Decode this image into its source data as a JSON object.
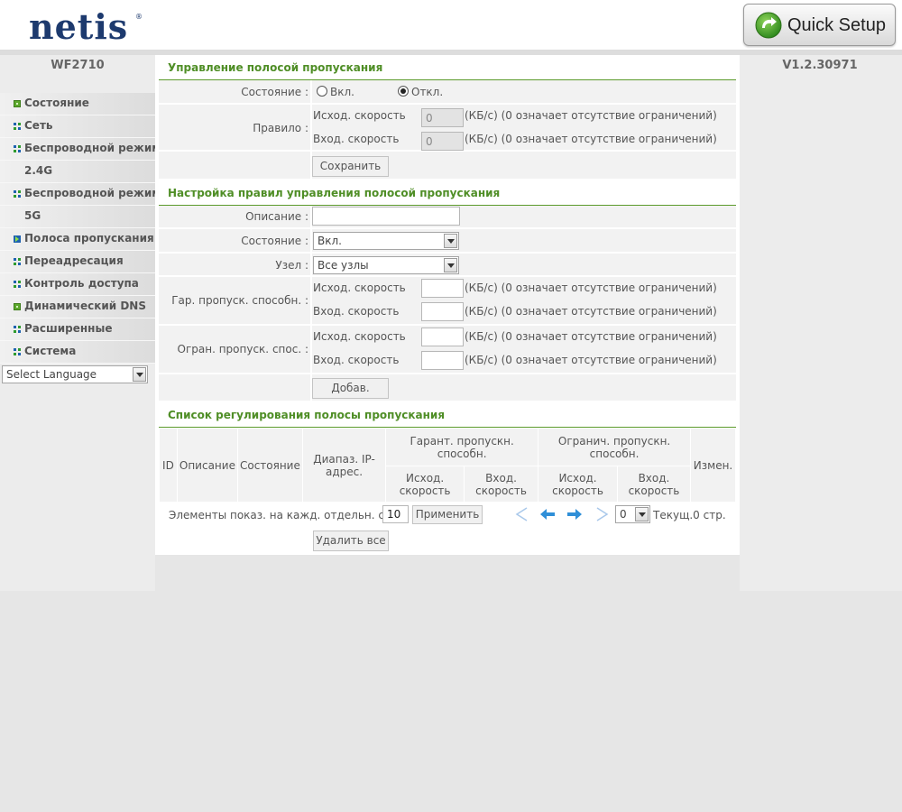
{
  "header": {
    "logo": "netis",
    "logo_mark": "®",
    "quick_setup_label": "Quick Setup",
    "quick_setup_icon": "refresh-arrow-icon"
  },
  "sidebar": {
    "model": "WF2710",
    "items": [
      {
        "label": "Состояние",
        "icon": "status-icon"
      },
      {
        "label": "Сеть",
        "icon": "grid-icon"
      },
      {
        "label": "Беспроводной режим",
        "icon": "grid-icon"
      },
      {
        "label": "2.4G",
        "icon": ""
      },
      {
        "label": "Беспроводной режим",
        "icon": "grid-icon"
      },
      {
        "label": "5G",
        "icon": ""
      },
      {
        "label": "Полоса пропускания",
        "icon": "active-arrow-icon"
      },
      {
        "label": "Переадресация",
        "icon": "grid-icon"
      },
      {
        "label": "Контроль доступа",
        "icon": "grid-icon"
      },
      {
        "label": "Динамический DNS",
        "icon": "status-icon"
      },
      {
        "label": "Расширенные",
        "icon": "grid-icon"
      },
      {
        "label": "Система",
        "icon": "grid-icon"
      }
    ],
    "language": "Select Language"
  },
  "version": "V1.2.30971",
  "bandwidth_control": {
    "title": "Управление полосой пропускания",
    "state_label": "Состояние :",
    "on_label": "Вкл.",
    "off_label": "Откл.",
    "selected": "off",
    "rule_label": "Правило :",
    "upload_label": "Исход. скорость",
    "download_label": "Вход. скорость",
    "upload_value": "0",
    "download_value": "0",
    "hint": "(КБ/с) (0 означает отсутствие ограничений)",
    "save_button": "Сохранить"
  },
  "rule_setup": {
    "title": "Настройка правил управления полосой пропускания",
    "description_label": "Описание :",
    "description_value": "",
    "state_label": "Состояние :",
    "state_value": "Вкл.",
    "node_label": "Узел :",
    "node_value": "Все узлы",
    "guaranteed_label": "Гар. пропуск. способн. :",
    "limited_label": "Огран. пропуск. спос. :",
    "upload_label": "Исход. скорость",
    "download_label": "Вход. скорость",
    "hint": "(КБ/с) (0 означает отсутствие ограничений)",
    "add_button": "Добав."
  },
  "rule_list": {
    "title": "Список регулирования полосы пропускания",
    "columns": {
      "id": "ID",
      "description": "Описание",
      "state": "Состояние",
      "ip_range": "Диапаз. IP-адрес.",
      "guaranteed": "Гарант. пропускн. способн.",
      "limited": "Огранич. пропускн. способн.",
      "edit": "Измен.",
      "upload": "Исход. скорость",
      "download": "Вход. скорость"
    },
    "per_page_label": "Элементы показ. на кажд. отдельн. стр.",
    "per_page_value": "10",
    "apply_button": "Применить",
    "page_select_value": "0",
    "current_page_text": "Текущ.0 стр.",
    "delete_all_button": "Удалить все"
  }
}
